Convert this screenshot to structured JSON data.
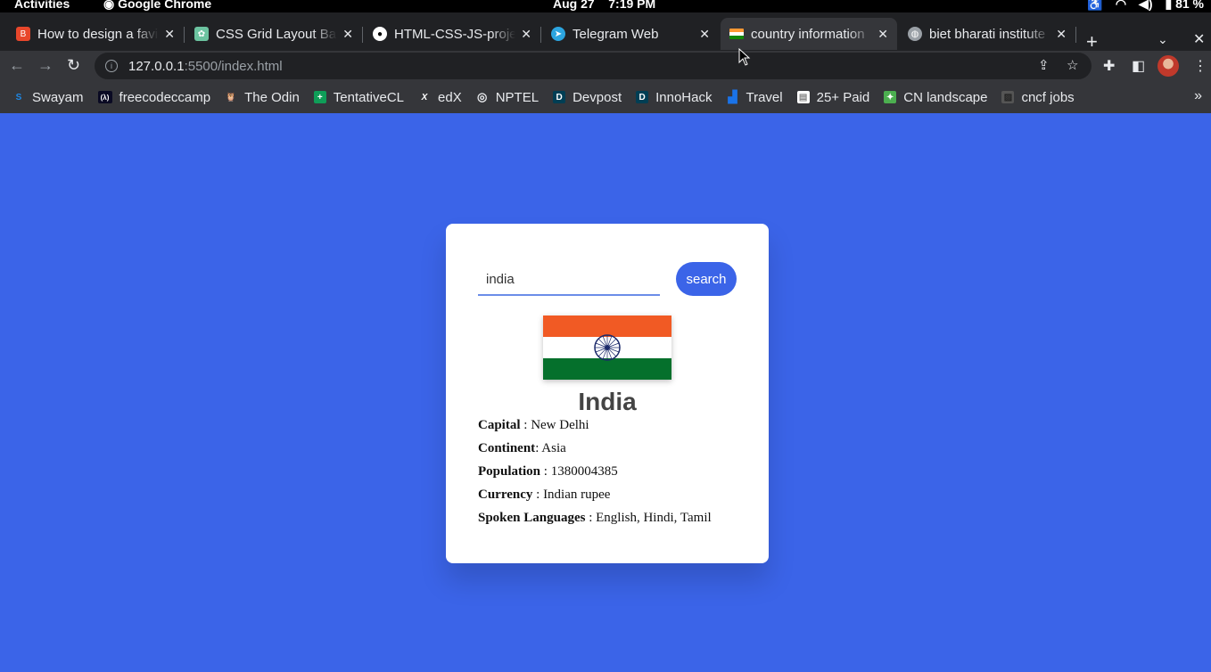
{
  "system_bar": {
    "activities": "Activities",
    "app": "Google Chrome",
    "date": "Aug 27",
    "time": "7:19 PM",
    "battery": "81 %"
  },
  "tabs": [
    {
      "title": "How to design a favi",
      "favicon_color": "#e8472b"
    },
    {
      "title": "CSS Grid Layout Basi",
      "favicon_color": "#6cc3a0"
    },
    {
      "title": "HTML-CSS-JS-proje",
      "favicon_color": "#ffffff"
    },
    {
      "title": "Telegram Web",
      "favicon_color": "#2ca5e0"
    },
    {
      "title": "country information",
      "favicon_color": "#ff9933"
    },
    {
      "title": "biet bharati institute",
      "favicon_color": "#9aa0a6"
    }
  ],
  "address_bar": {
    "host": "127.0.0.1",
    "path": ":5500/index.html"
  },
  "bookmarks": [
    {
      "label": "Swayam",
      "icon": "S",
      "color": "#1e88e5"
    },
    {
      "label": "freecodeccamp",
      "icon": "(λ)",
      "color": "#0a0a23"
    },
    {
      "label": "The Odin",
      "icon": "🦉",
      "color": "#35363a"
    },
    {
      "label": "TentativeCL",
      "icon": "+",
      "color": "#0f9d58"
    },
    {
      "label": "edX",
      "icon": "X",
      "color": "#35363a"
    },
    {
      "label": "NPTEL",
      "icon": "◎",
      "color": "#35363a"
    },
    {
      "label": "Devpost",
      "icon": "D",
      "color": "#003e54"
    },
    {
      "label": "InnoHack",
      "icon": "D",
      "color": "#003e54"
    },
    {
      "label": "Travel",
      "icon": "▟",
      "color": "#1a73e8"
    },
    {
      "label": "25+ Paid",
      "icon": "▤",
      "color": "#ffffff"
    },
    {
      "label": "CN landscape",
      "icon": "✦",
      "color": "#4caf50"
    },
    {
      "label": "cncf jobs",
      "icon": "▨",
      "color": "#555555"
    }
  ],
  "page": {
    "search_value": "india",
    "search_button": "search",
    "country_name": "India",
    "fields": [
      {
        "label": "Capital",
        "sep": " : ",
        "value": "New Delhi"
      },
      {
        "label": "Continent",
        "sep": ": ",
        "value": "Asia"
      },
      {
        "label": "Population",
        "sep": " : ",
        "value": "1380004385"
      },
      {
        "label": "Currency",
        "sep": " : ",
        "value": "Indian rupee"
      },
      {
        "label": "Spoken Languages",
        "sep": " : ",
        "value": "English, Hindi, Tamil"
      }
    ],
    "flag_colors": {
      "saffron": "#f15a24",
      "white": "#ffffff",
      "green": "#05702c",
      "chakra": "#1c2a6b"
    },
    "background": "#3b64e8"
  }
}
